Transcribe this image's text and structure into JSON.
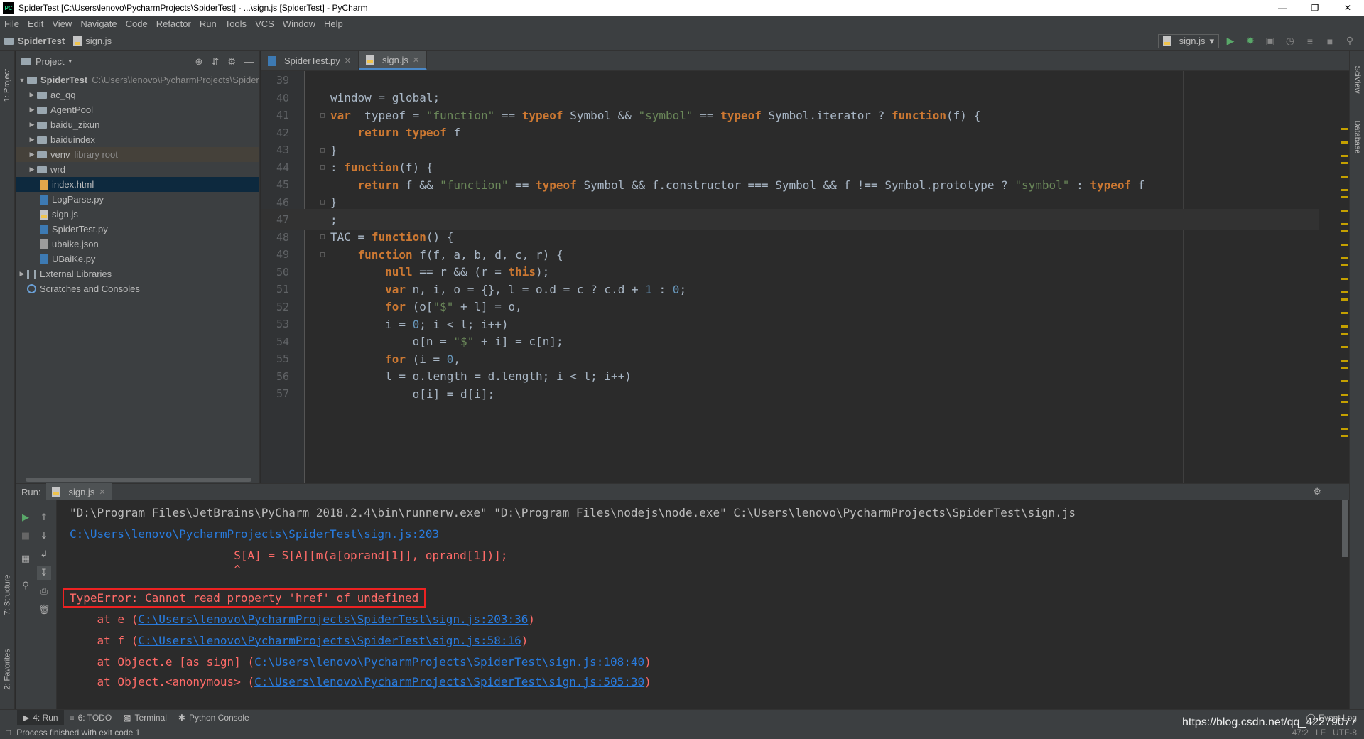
{
  "window": {
    "title": "SpiderTest [C:\\Users\\lenovo\\PycharmProjects\\SpiderTest] - ...\\sign.js [SpiderTest] - PyCharm",
    "logo_text": "PC"
  },
  "menu": [
    "File",
    "Edit",
    "View",
    "Navigate",
    "Code",
    "Refactor",
    "Run",
    "Tools",
    "VCS",
    "Window",
    "Help"
  ],
  "breadcrumb": {
    "project": "SpiderTest",
    "file": "sign.js"
  },
  "run_config": {
    "label": "sign.js"
  },
  "side_tabs": {
    "project": "1: Project",
    "structure": "7: Structure",
    "favorites": "2: Favorites",
    "sciview": "SciView",
    "database": "Database"
  },
  "project_panel": {
    "title": "Project",
    "root": {
      "name": "SpiderTest",
      "path": "C:\\Users\\lenovo\\PycharmProjects\\Spider"
    },
    "folders": [
      "ac_qq",
      "AgentPool",
      "baidu_zixun",
      "baiduindex"
    ],
    "venv": {
      "name": "venv",
      "note": "library root"
    },
    "wrd": "wrd",
    "files": [
      "index.html",
      "LogParse.py",
      "sign.js",
      "SpiderTest.py",
      "ubaike.json",
      "UBaiKe.py"
    ],
    "external": "External Libraries",
    "scratches": "Scratches and Consoles"
  },
  "editor_tabs": [
    {
      "label": "SpiderTest.py",
      "active": false
    },
    {
      "label": "sign.js",
      "active": true
    }
  ],
  "code_lines": [
    {
      "n": "39",
      "text": ""
    },
    {
      "n": "40",
      "text": "window = global;"
    },
    {
      "n": "41",
      "text": "var _typeof = \"function\" == typeof Symbol && \"symbol\" == typeof Symbol.iterator ? function(f) {"
    },
    {
      "n": "42",
      "text": "    return typeof f"
    },
    {
      "n": "43",
      "text": "}"
    },
    {
      "n": "44",
      "text": ": function(f) {"
    },
    {
      "n": "45",
      "text": "    return f && \"function\" == typeof Symbol && f.constructor === Symbol && f !== Symbol.prototype ? \"symbol\" : typeof f"
    },
    {
      "n": "46",
      "text": "}"
    },
    {
      "n": "47",
      "text": ";"
    },
    {
      "n": "48",
      "text": "TAC = function() {"
    },
    {
      "n": "49",
      "text": "    function f(f, a, b, d, c, r) {"
    },
    {
      "n": "50",
      "text": "        null == r && (r = this);"
    },
    {
      "n": "51",
      "text": "        var n, i, o = {}, l = o.d = c ? c.d + 1 : 0;"
    },
    {
      "n": "52",
      "text": "        for (o[\"$\" + l] = o,"
    },
    {
      "n": "53",
      "text": "        i = 0; i < l; i++)"
    },
    {
      "n": "54",
      "text": "            o[n = \"$\" + i] = c[n];"
    },
    {
      "n": "55",
      "text": "        for (i = 0,"
    },
    {
      "n": "56",
      "text": "        l = o.length = d.length; i < l; i++)"
    },
    {
      "n": "57",
      "text": "            o[i] = d[i];"
    }
  ],
  "run_panel": {
    "label": "Run:",
    "tab": "sign.js"
  },
  "console": {
    "cmd": "\"D:\\Program Files\\JetBrains\\PyCharm 2018.2.4\\bin\\runnerw.exe\" \"D:\\Program Files\\nodejs\\node.exe\" C:\\Users\\lenovo\\PycharmProjects\\SpiderTest\\sign.js",
    "loc_link": "C:\\Users\\lenovo\\PycharmProjects\\SpiderTest\\sign.js:203",
    "src_line": "                        S[A] = S[A][m(a[oprand[1]], oprand[1])];",
    "caret": "                        ^",
    "error": "TypeError: Cannot read property 'href' of undefined",
    "stack": [
      {
        "prefix": "    at e (",
        "link": "C:\\Users\\lenovo\\PycharmProjects\\SpiderTest\\sign.js:203:36",
        "suffix": ")"
      },
      {
        "prefix": "    at f (",
        "link": "C:\\Users\\lenovo\\PycharmProjects\\SpiderTest\\sign.js:58:16",
        "suffix": ")"
      },
      {
        "prefix": "    at Object.e [as sign] (",
        "link": "C:\\Users\\lenovo\\PycharmProjects\\SpiderTest\\sign.js:108:40",
        "suffix": ")"
      },
      {
        "prefix": "    at Object.<anonymous> (",
        "link": "C:\\Users\\lenovo\\PycharmProjects\\SpiderTest\\sign.js:505:30",
        "suffix": ")"
      }
    ]
  },
  "bottom_tabs": [
    "4: Run",
    "6: TODO",
    "Terminal",
    "Python Console"
  ],
  "event_log": "Event Log",
  "status": {
    "message": "Process finished with exit code 1",
    "position": "47:2",
    "line_sep": "LF",
    "encoding": "UTF-8"
  },
  "watermark": "https://blog.csdn.net/qq_42279077",
  "colors": {
    "keyword": "#cc7832",
    "string": "#6a8759",
    "link": "#287bde",
    "error": "#ff6b68",
    "accent": "#4a88c7"
  }
}
